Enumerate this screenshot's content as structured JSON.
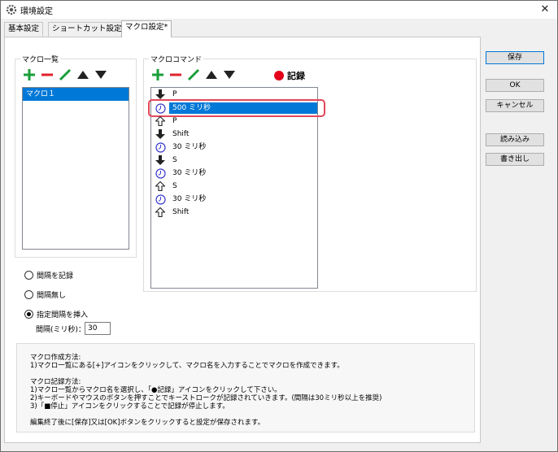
{
  "window": {
    "title": "環境設定",
    "close": "✕"
  },
  "tabs": [
    {
      "label": "基本設定"
    },
    {
      "label": "ショートカット設定"
    },
    {
      "label": "マクロ設定*"
    }
  ],
  "macro_list": {
    "title": "マクロ一覧",
    "items": [
      "マクロ１"
    ],
    "selected_index": 0
  },
  "macro_commands": {
    "title": "マクロコマンド",
    "record_label": "記録",
    "rows": [
      {
        "icon": "key-down-arrow-icon",
        "label": "P"
      },
      {
        "icon": "clock-icon",
        "label": "500 ミリ秒",
        "selected": true
      },
      {
        "icon": "key-up-arrow-icon",
        "label": "P"
      },
      {
        "icon": "key-down-arrow-icon",
        "label": "Shift"
      },
      {
        "icon": "clock-icon",
        "label": "30 ミリ秒"
      },
      {
        "icon": "key-down-arrow-icon",
        "label": "S"
      },
      {
        "icon": "clock-icon",
        "label": "30 ミリ秒"
      },
      {
        "icon": "key-up-arrow-icon",
        "label": "S"
      },
      {
        "icon": "clock-icon",
        "label": "30 ミリ秒"
      },
      {
        "icon": "key-up-arrow-icon",
        "label": "Shift"
      }
    ]
  },
  "options": {
    "record_interval": "間隔を記録",
    "no_interval": "間隔無し",
    "insert_interval": "指定間隔を挿入",
    "selected": "insert_interval",
    "interval_label": "間隔(ミリ秒)：",
    "interval_value": "30"
  },
  "help": {
    "lines": [
      "マクロ作成方法:",
      "1)マクロ一覧にある[+]アイコンをクリックして、マクロ名を入力することでマクロを作成できます。",
      "",
      "マクロ記録方法:",
      "1)マクロ一覧からマクロ名を選択し、「●記録」アイコンをクリックして下さい。",
      "2)キーボードやマウスのボタンを押すことでキーストロークが記録されていきます。(間隔は30ミリ秒以上を推奨)",
      "3)「■停止」アイコンをクリックすることで記録が停止します。",
      "",
      "編集終了後に[保存]又は[OK]ボタンをクリックすると設定が保存されます。"
    ]
  },
  "buttons": {
    "save": "保存",
    "ok": "OK",
    "cancel": "キャンセル",
    "load": "読み込み",
    "export": "書き出し"
  },
  "colors": {
    "add": "#1a9e3a",
    "remove": "#e0212e",
    "edit": "#1a9e3a",
    "selection": "#0078d7",
    "record": "#e4001b",
    "highlight": "#e0485a"
  }
}
